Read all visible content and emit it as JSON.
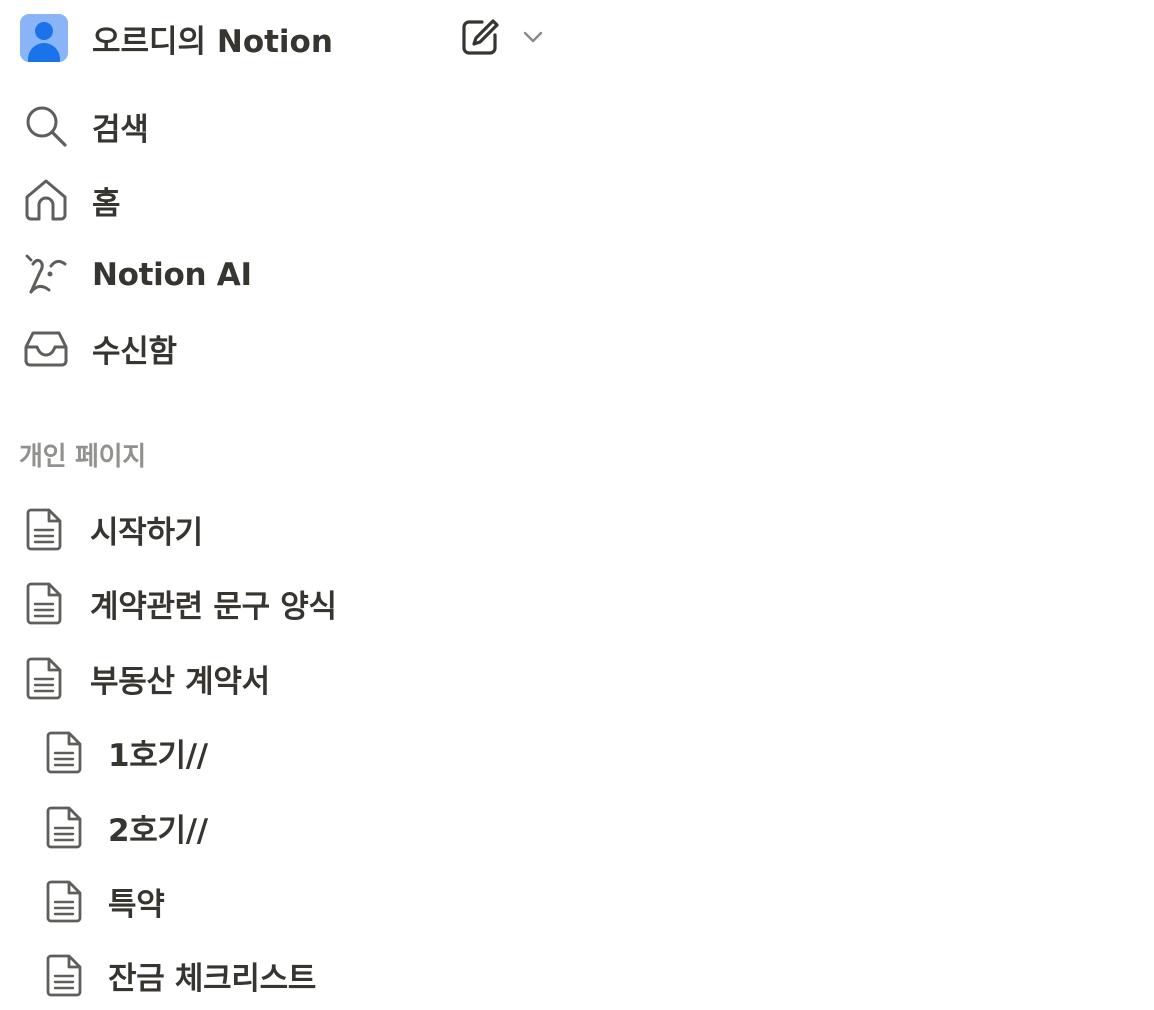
{
  "workspace": {
    "name": "오르디의 Notion",
    "avatar_icon": "user-avatar-icon",
    "avatar_color": "#8ab4f8",
    "avatar_accent": "#1a73e8",
    "compose_icon": "compose-icon",
    "switcher_icon": "chevron-down-icon"
  },
  "nav": {
    "search": {
      "label": "검색",
      "icon": "search-icon"
    },
    "home": {
      "label": "홈",
      "icon": "home-icon"
    },
    "ai": {
      "label": "Notion AI",
      "icon": "notion-ai-icon"
    },
    "inbox": {
      "label": "수신함",
      "icon": "inbox-icon"
    }
  },
  "private_section": {
    "title": "개인 페이지",
    "pages": [
      {
        "label": "시작하기",
        "icon": "page-icon"
      },
      {
        "label": "계약관련 문구 양식",
        "icon": "page-icon"
      },
      {
        "label": "부동산 계약서",
        "icon": "page-icon",
        "children": [
          {
            "label": "1호기//",
            "icon": "page-icon"
          },
          {
            "label": "2호기//",
            "icon": "page-icon"
          },
          {
            "label": "특약",
            "icon": "page-icon"
          },
          {
            "label": "잔금 체크리스트",
            "icon": "page-icon"
          }
        ]
      }
    ]
  },
  "colors": {
    "text": "#37352f",
    "muted": "#91918e",
    "icon": "#5f5e5b",
    "background": "#ffffff"
  }
}
